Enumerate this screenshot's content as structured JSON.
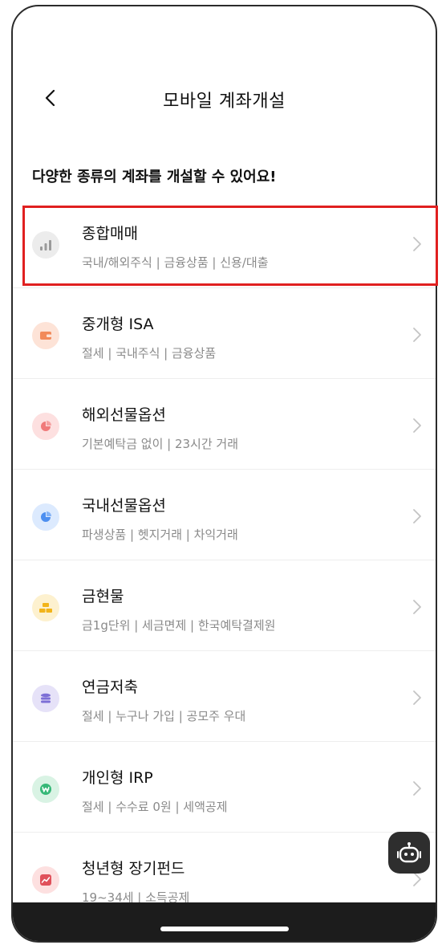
{
  "header": {
    "title": "모바일 계좌개설"
  },
  "subtitle": "다양한 종류의 계좌를 개설할 수 있어요!",
  "colors": {
    "highlight": "#e02020",
    "text": "#111111",
    "muted": "#8a8a8a"
  },
  "items": [
    {
      "name": "종합매매",
      "desc": "국내/해외주식 | 금융상품 | 신용/대출",
      "icon": "bar-chart-icon",
      "bg": "#ececec",
      "fg": "#9a9a9a"
    },
    {
      "name": "중개형 ISA",
      "desc": "절세 | 국내주식 | 금융상품",
      "icon": "wallet-icon",
      "bg": "#fde3d7",
      "fg": "#f28a5a"
    },
    {
      "name": "해외선물옵션",
      "desc": "기본예탁금 없이 | 23시간 거래",
      "icon": "pie-chart-icon",
      "bg": "#fde0e0",
      "fg": "#f07a7a"
    },
    {
      "name": "국내선물옵션",
      "desc": "파생상품 | 헷지거래 | 차익거래",
      "icon": "pie-chart-icon",
      "bg": "#dceafe",
      "fg": "#4d8ff0"
    },
    {
      "name": "금현물",
      "desc": "금1g단위 | 세금면제 | 한국예탁결제원",
      "icon": "gold-bars-icon",
      "bg": "#fdf1cf",
      "fg": "#f2b41a"
    },
    {
      "name": "연금저축",
      "desc": "절세 | 누구나 가입 | 공모주 우대",
      "icon": "coin-stack-icon",
      "bg": "#e6e2f8",
      "fg": "#7d6fd6"
    },
    {
      "name": "개인형 IRP",
      "desc": "절세 | 수수료 0원 | 세액공제",
      "icon": "won-badge-icon",
      "bg": "#d9f3e4",
      "fg": "#36b877"
    },
    {
      "name": "청년형 장기펀드",
      "desc": "19~34세 | 소득공제",
      "icon": "trend-chart-icon",
      "bg": "#fde0e0",
      "fg": "#e0505a"
    }
  ]
}
